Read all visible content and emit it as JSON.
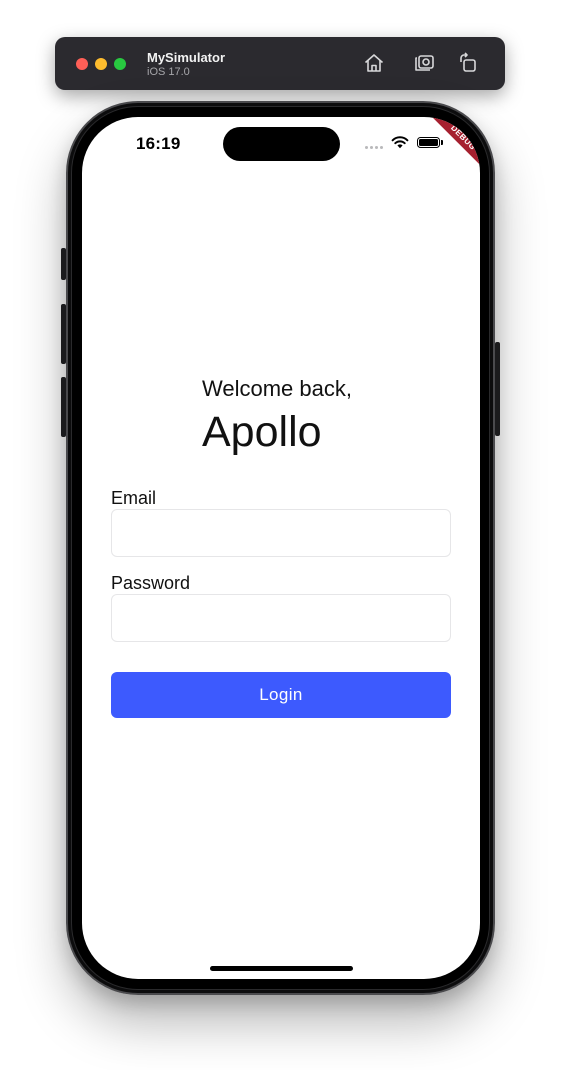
{
  "simulator": {
    "title": "MySimulator",
    "subtitle": "iOS 17.0",
    "toolbar_icons": [
      "home-icon",
      "camera-icon",
      "rotate-icon"
    ],
    "traffic_light_colors": [
      "#fe5f57",
      "#febc2e",
      "#28c840"
    ]
  },
  "status_bar": {
    "time": "16:19",
    "icons": [
      "signal-dots-icon",
      "wifi-icon",
      "battery-icon"
    ]
  },
  "debug_banner": {
    "label": "DEBUG",
    "color": "#a6202f"
  },
  "login": {
    "greeting": "Welcome back,",
    "user_name": "Apollo",
    "email_label": "Email",
    "email_value": "",
    "password_label": "Password",
    "password_value": "",
    "login_button_label": "Login",
    "accent_color": "#3d5afe"
  }
}
